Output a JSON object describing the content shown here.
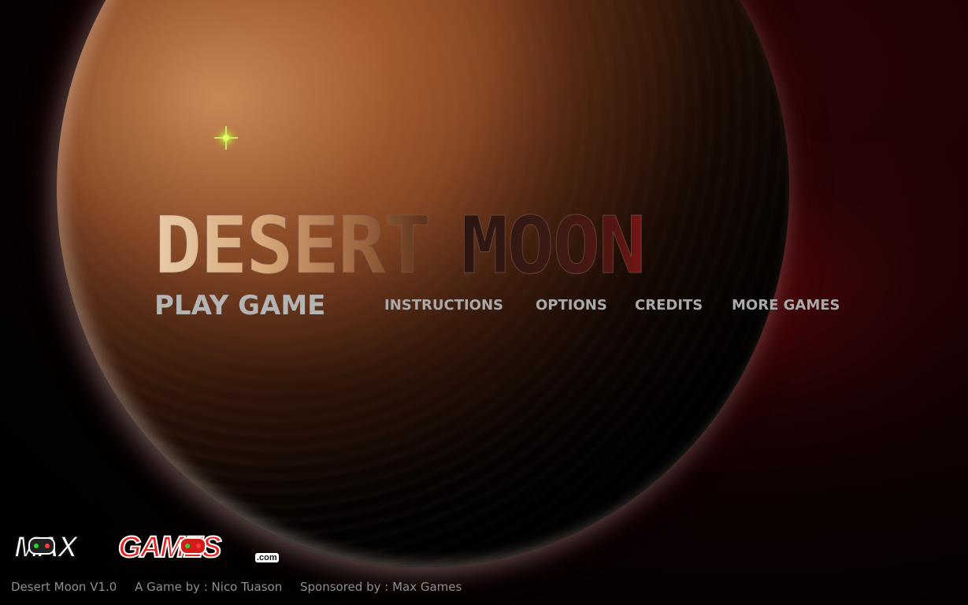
{
  "game": {
    "title_word1": "Desert",
    "title_word2": "Moon"
  },
  "menu": {
    "play": "Play Game",
    "instructions": "Instructions",
    "options": "Options",
    "credits": "Credits",
    "more_games": "More Games"
  },
  "sponsor_logo": {
    "part1": "MAX",
    "part2": "GAMES",
    "suffix": ".com",
    "icon": "gamepad-icon"
  },
  "footer": {
    "version": "Desert Moon V1.0",
    "author": "A Game by : Nico Tuason",
    "sponsor": "Sponsored by : Max Games"
  },
  "colors": {
    "background": "#000000",
    "planet": "#8a4a24",
    "title_light": "#e2c09a",
    "title_dark": "#3a1a14",
    "title_red": "#7a1616",
    "menu_text": "#a9a9a9",
    "star": "#d8ff60",
    "logo_red": "#e8211f"
  }
}
